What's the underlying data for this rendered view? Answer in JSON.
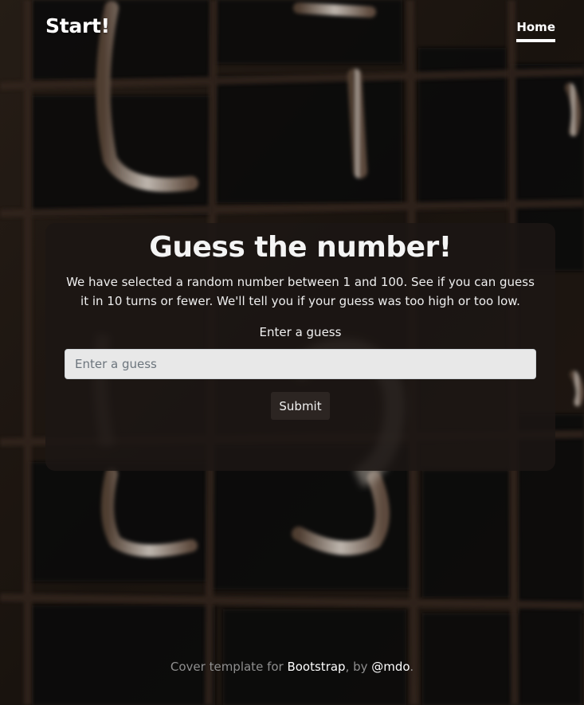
{
  "header": {
    "brand": "Start!",
    "nav_home": "Home"
  },
  "main": {
    "title": "Guess the number!",
    "description": "We have selected a random number between 1 and 100. See if you can guess it in 10 turns or fewer. We'll tell you if your guess was too high or too low.",
    "label": "Enter a guess",
    "input_placeholder": "Enter a guess",
    "submit_label": "Submit"
  },
  "footer": {
    "prefix": "Cover template for ",
    "bootstrap_link": "Bootstrap",
    "middle": ", by ",
    "author_link": "@mdo",
    "suffix": "."
  },
  "colors": {
    "background": "#201813",
    "card": "#1c1614",
    "text": "#f1f1f1",
    "muted_text": "#8f8f8f",
    "input_bg": "#e8e8e8",
    "button_bg": "#2c2522"
  }
}
